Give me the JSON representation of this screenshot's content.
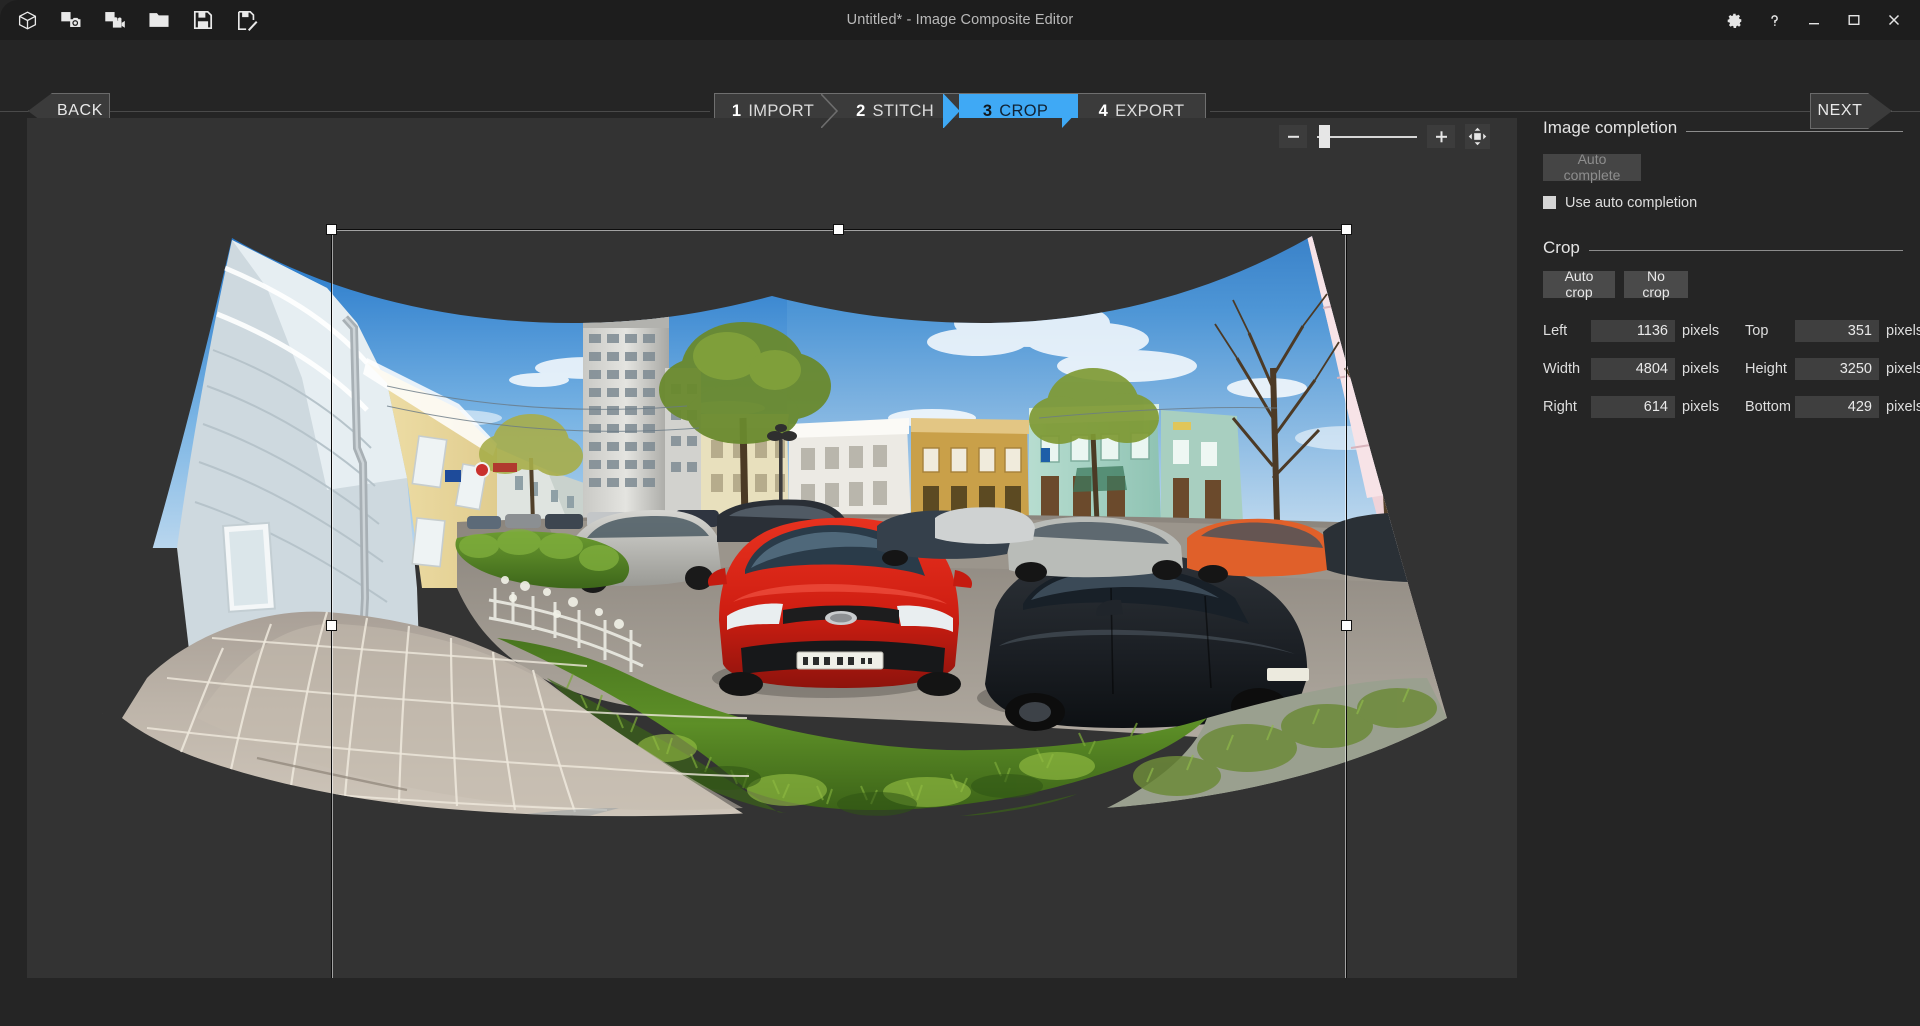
{
  "window": {
    "title": "Untitled* - Image Composite Editor",
    "toolbar": [
      {
        "name": "new-panorama-icon",
        "label": "New panorama"
      },
      {
        "name": "new-from-images-icon",
        "label": "New panorama from images"
      },
      {
        "name": "new-from-video-icon",
        "label": "New panorama from video"
      },
      {
        "name": "open-icon",
        "label": "Open"
      },
      {
        "name": "save-icon",
        "label": "Save"
      },
      {
        "name": "save-as-icon",
        "label": "Save as"
      }
    ],
    "controls": [
      {
        "name": "settings-icon",
        "label": "Settings"
      },
      {
        "name": "help-icon",
        "label": "Help"
      },
      {
        "name": "minimize-icon",
        "label": "Minimize"
      },
      {
        "name": "maximize-icon",
        "label": "Maximize"
      },
      {
        "name": "close-icon",
        "label": "Close"
      }
    ]
  },
  "nav": {
    "back_label": "BACK",
    "next_label": "NEXT",
    "steps": [
      {
        "num": "1",
        "label": "IMPORT",
        "active": false
      },
      {
        "num": "2",
        "label": "STITCH",
        "active": false
      },
      {
        "num": "3",
        "label": "CROP",
        "active": true
      },
      {
        "num": "4",
        "label": "EXPORT",
        "active": false
      }
    ],
    "active_color": "#3fa9f5"
  },
  "zoom_controls": {
    "zoom_out_label": "−",
    "zoom_in_label": "+",
    "fit_label": "Fit to window",
    "slider_position_pct": 3
  },
  "panel": {
    "image_completion": {
      "title": "Image completion",
      "auto_complete_label": "Auto complete",
      "auto_complete_enabled": false,
      "use_auto_completion_label": "Use auto completion",
      "use_auto_completion_checked": false
    },
    "crop": {
      "title": "Crop",
      "auto_crop_label": "Auto crop",
      "no_crop_label": "No crop",
      "unit_label": "pixels",
      "fields": {
        "left": {
          "label": "Left",
          "value": "1136"
        },
        "top": {
          "label": "Top",
          "value": "351"
        },
        "width": {
          "label": "Width",
          "value": "4804"
        },
        "height": {
          "label": "Height",
          "value": "3250"
        },
        "right": {
          "label": "Right",
          "value": "614"
        },
        "bottom": {
          "label": "Bottom",
          "value": "429"
        }
      }
    }
  },
  "canvas": {
    "image_description": "Stitched panorama of a city street with parked cars, sidewalk, green hedge and historic buildings",
    "background_color": "#333333",
    "crop_selection": {
      "handles": 8
    }
  }
}
